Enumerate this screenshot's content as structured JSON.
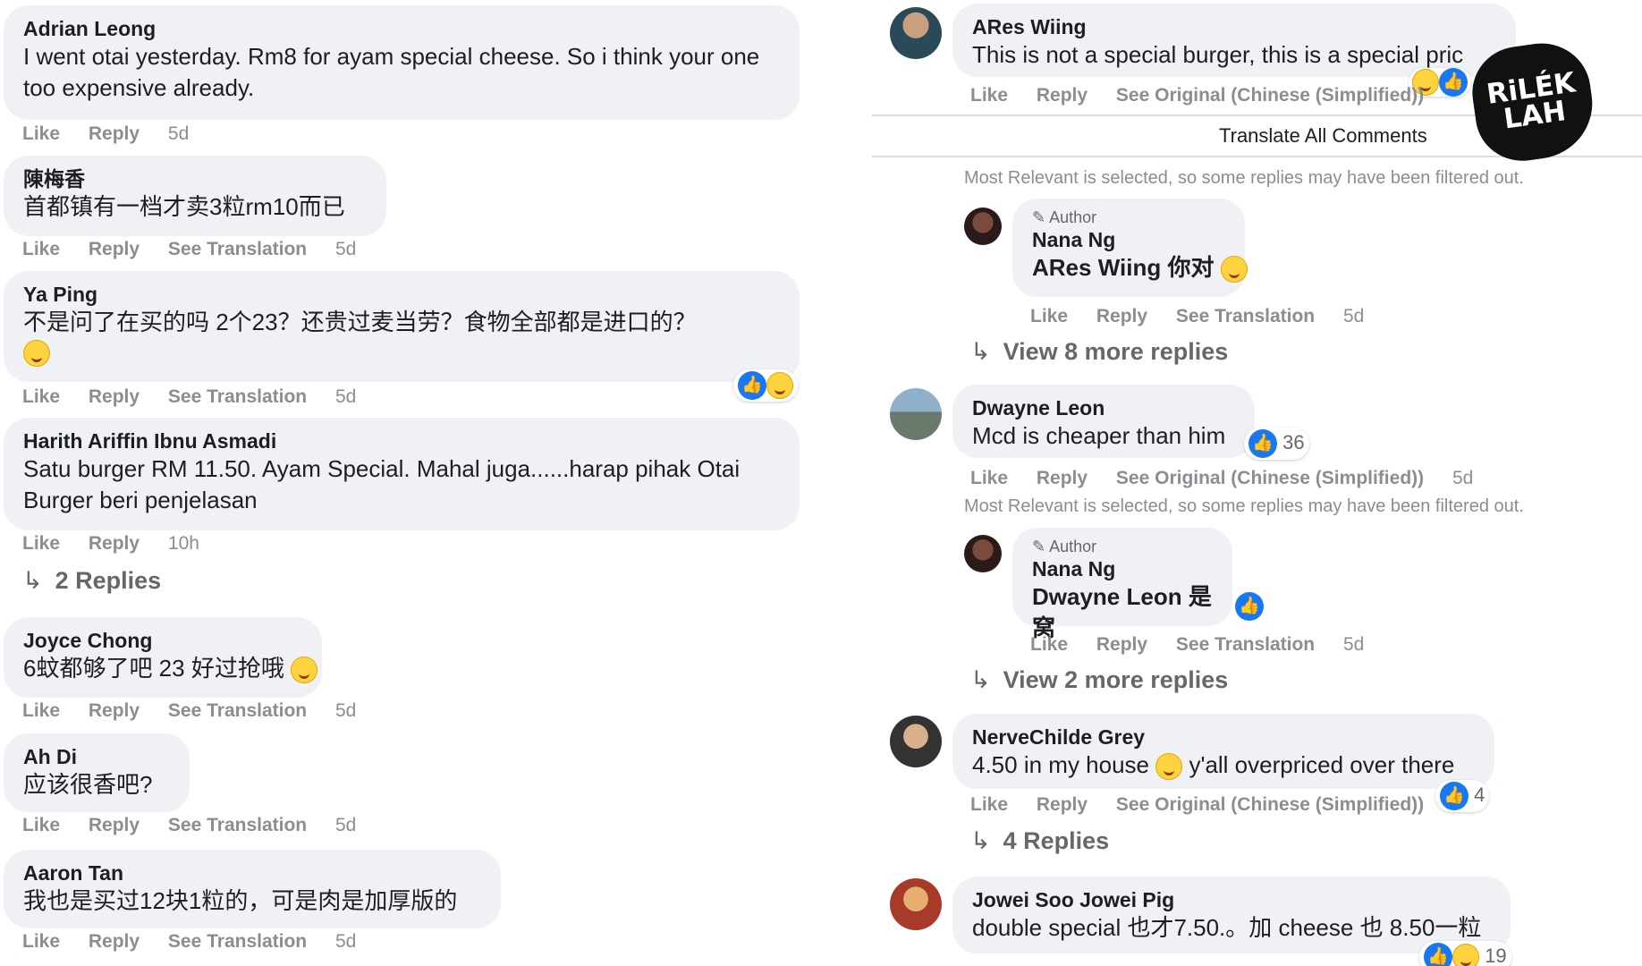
{
  "left": {
    "comments": [
      {
        "name": "Adrian Leong",
        "text": "I went otai yesterday. Rm8 for ayam special cheese. So i think your one too expensive already.",
        "actions": [
          "Like",
          "Reply"
        ],
        "time": "5d"
      },
      {
        "name": "陳梅香",
        "text": "首都镇有一档才卖3粒rm10而已",
        "actions": [
          "Like",
          "Reply",
          "See Translation"
        ],
        "time": "5d"
      },
      {
        "name": "Ya Ping",
        "text": "不是问了在买的吗 2个23？还贵过麦当劳？食物全部都是进口的？",
        "actions": [
          "Like",
          "Reply",
          "See Translation"
        ],
        "time": "5d"
      },
      {
        "name": "Harith Ariffin Ibnu Asmadi",
        "text": "Satu burger RM 11.50. Ayam Special. Mahal juga......harap pihak Otai Burger beri penjelasan",
        "actions": [
          "Like",
          "Reply"
        ],
        "time": "10h",
        "replies": "2 Replies"
      },
      {
        "name": "Joyce Chong",
        "text": "6蚊都够了吧 23 好过抢哦",
        "actions": [
          "Like",
          "Reply",
          "See Translation"
        ],
        "time": "5d"
      },
      {
        "name": "Ah Di",
        "text": "应该很香吧?",
        "actions": [
          "Like",
          "Reply",
          "See Translation"
        ],
        "time": "5d"
      },
      {
        "name": "Aaron Tan",
        "text": "我也是买过12块1粒的，可是肉是加厚版的",
        "actions": [
          "Like",
          "Reply",
          "See Translation"
        ],
        "time": "5d"
      }
    ]
  },
  "right": {
    "top_comment": {
      "name": "ARes Wiing",
      "text": "This is not a special burger, this is a special pric",
      "actions": [
        "Like",
        "Reply",
        "See Original (Chinese (Simplified))"
      ]
    },
    "translate_all": "Translate All Comments",
    "filter_note": "Most Relevant is selected, so some replies may have been filtered out.",
    "author_reply_1": {
      "tag": "Author",
      "name": "Nana Ng",
      "text": "ARes Wiing 你对",
      "actions": [
        "Like",
        "Reply",
        "See Translation"
      ],
      "time": "5d"
    },
    "more_replies_1": "View 8 more replies",
    "comment_2": {
      "name": "Dwayne Leon",
      "text": "Mcd is cheaper than him",
      "reactions": "36",
      "actions": [
        "Like",
        "Reply",
        "See Original (Chinese (Simplified))"
      ],
      "time": "5d"
    },
    "author_reply_2": {
      "tag": "Author",
      "name": "Nana Ng",
      "text": "Dwayne Leon 是窝",
      "actions": [
        "Like",
        "Reply",
        "See Translation"
      ],
      "time": "5d"
    },
    "more_replies_2": "View 2 more replies",
    "comment_3": {
      "name": "NerveChilde Grey",
      "text_a": "4.50 in my house",
      "text_b": "y'all overpriced over there",
      "reactions": "4",
      "actions": [
        "Like",
        "Reply",
        "See Original (Chinese (Simplified))"
      ],
      "replies": "4 Replies"
    },
    "comment_4": {
      "name": "Jowei Soo Jowei Pig",
      "text": "double special 也才7.50.。加 cheese 也 8.50一粒",
      "reactions": "19"
    }
  },
  "logo_text": "RiLÉK LAH",
  "colors": {
    "bubble": "#eff1f4",
    "meta": "#8a8d91",
    "like_blue": "#1877f2"
  }
}
